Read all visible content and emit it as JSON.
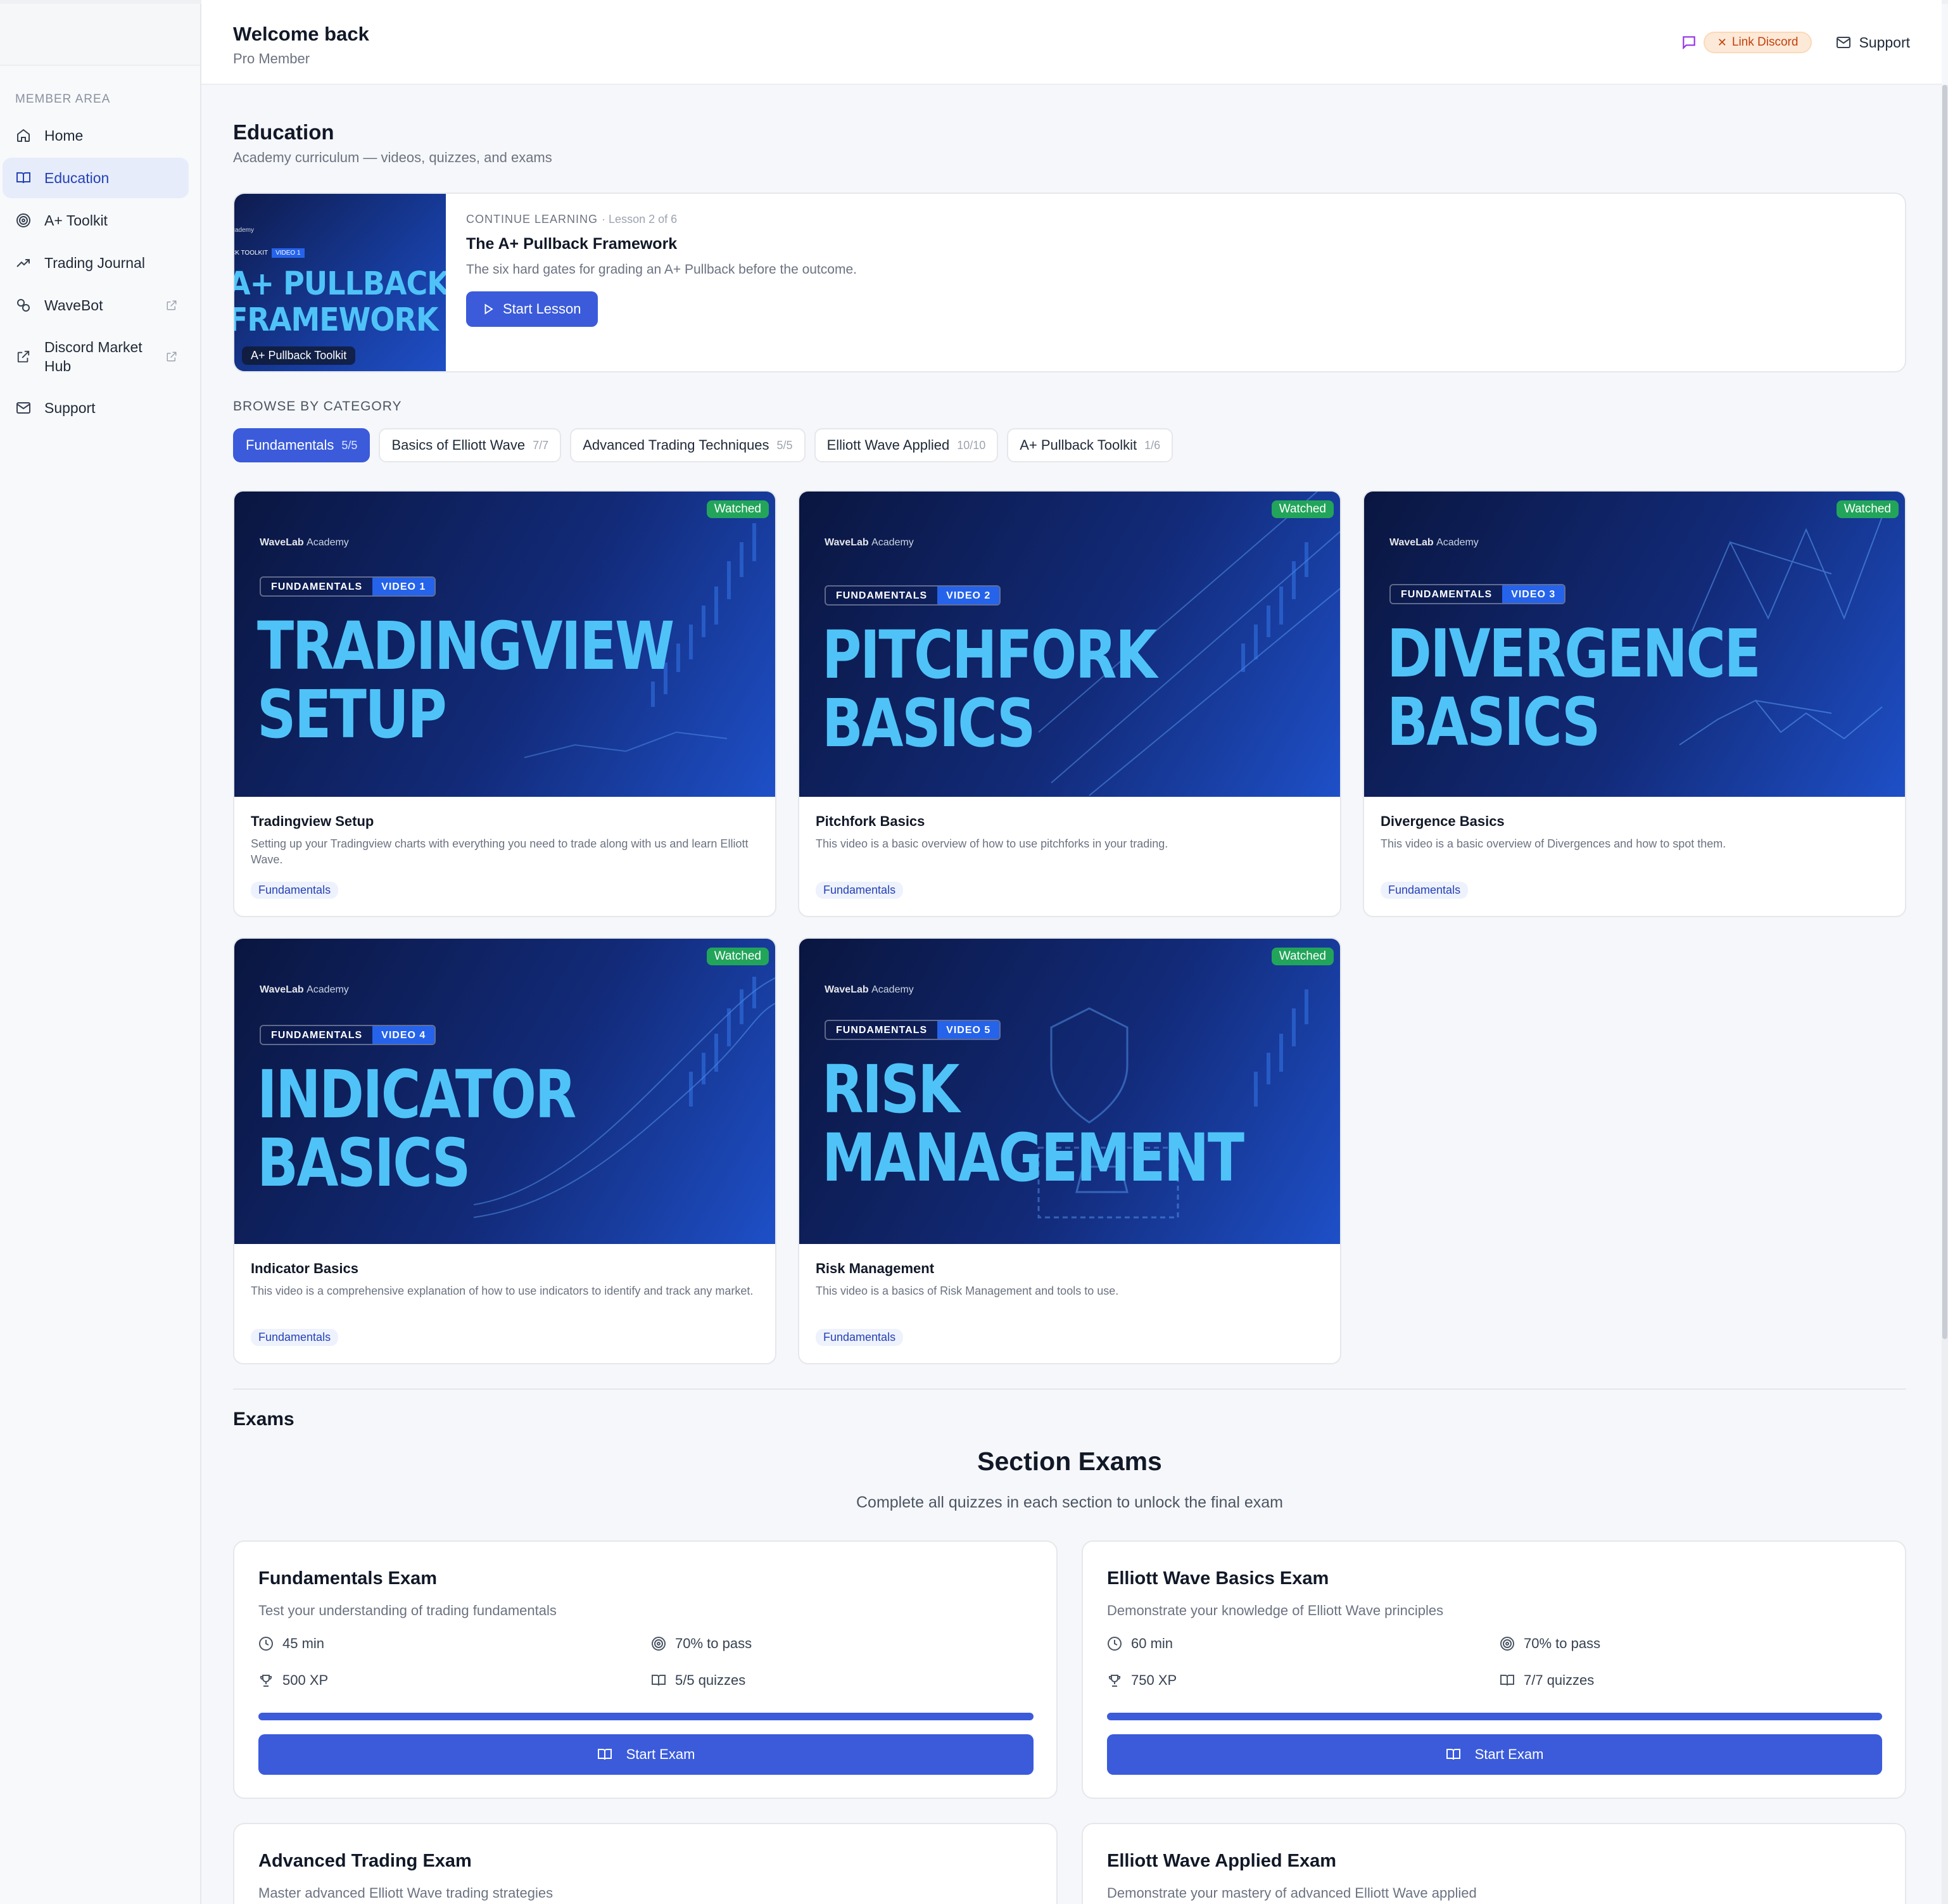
{
  "header": {
    "welcome": "Welcome back",
    "membership": "Pro Member",
    "discord_label": "Link Discord",
    "support_label": "Support"
  },
  "sidebar": {
    "section_label": "MEMBER AREA",
    "items": [
      {
        "label": "Home",
        "icon": "home-icon"
      },
      {
        "label": "Education",
        "icon": "book-icon",
        "active": true
      },
      {
        "label": "A+ Toolkit",
        "icon": "target-icon"
      },
      {
        "label": "Trading Journal",
        "icon": "trending-up-icon"
      },
      {
        "label": "WaveBot",
        "icon": "bot-icon",
        "external": true
      },
      {
        "label": "Discord Market Hub",
        "icon": "external-link-icon",
        "external": true
      },
      {
        "label": "Support",
        "icon": "mail-icon"
      }
    ]
  },
  "page": {
    "title": "Education",
    "subtitle": "Academy curriculum — videos, quizzes, and exams"
  },
  "continue": {
    "eyebrow": "CONTINUE LEARNING",
    "progress": "· Lesson 2 of 6",
    "title": "The A+ Pullback Framework",
    "description": "The six hard gates for grading an A+ Pullback before the outcome.",
    "button": "Start Lesson",
    "thumb_title": "A+ PULLBACK FRAMEWORK",
    "thumb_tag": "CK TOOLKIT",
    "thumb_video": "VIDEO 1",
    "thumb_label": "A+ Pullback Toolkit",
    "thumb_brand": "cademy"
  },
  "browse": {
    "label": "BROWSE BY CATEGORY",
    "categories": [
      {
        "label": "Fundamentals",
        "count": "5/5",
        "active": true
      },
      {
        "label": "Basics of Elliott Wave",
        "count": "7/7"
      },
      {
        "label": "Advanced Trading Techniques",
        "count": "5/5"
      },
      {
        "label": "Elliott Wave Applied",
        "count": "10/10"
      },
      {
        "label": "A+ Pullback Toolkit",
        "count": "1/6"
      }
    ]
  },
  "videos": [
    {
      "title": "Tradingview Setup",
      "description": "Setting up your Tradingview charts with everything you need to trade along with us and learn Elliott Wave.",
      "badge": "Fundamentals",
      "status": "Watched",
      "thumb_line1": "TRADINGVIEW",
      "thumb_line2": "SETUP",
      "thumb_cat": "FUNDAMENTALS",
      "thumb_video": "VIDEO 1",
      "brand": "WaveLab",
      "brand_sub": "Academy"
    },
    {
      "title": "Pitchfork Basics",
      "description": "This video is a basic overview of how to use pitchforks in your trading.",
      "badge": "Fundamentals",
      "status": "Watched",
      "thumb_line1": "PITCHFORK",
      "thumb_line2": "BASICS",
      "thumb_cat": "FUNDAMENTALS",
      "thumb_video": "VIDEO 2",
      "brand": "WaveLab",
      "brand_sub": "Academy"
    },
    {
      "title": "Divergence Basics",
      "description": "This video is a basic overview of Divergences and how to spot them.",
      "badge": "Fundamentals",
      "status": "Watched",
      "thumb_line1": "DIVERGENCE",
      "thumb_line2": "BASICS",
      "thumb_cat": "FUNDAMENTALS",
      "thumb_video": "VIDEO 3",
      "brand": "WaveLab",
      "brand_sub": "Academy"
    },
    {
      "title": "Indicator Basics",
      "description": "This video is a comprehensive explanation of how to use indicators to identify and track any market.",
      "badge": "Fundamentals",
      "status": "Watched",
      "thumb_line1": "INDICATOR",
      "thumb_line2": "BASICS",
      "thumb_cat": "FUNDAMENTALS",
      "thumb_video": "VIDEO 4",
      "brand": "WaveLab",
      "brand_sub": "Academy"
    },
    {
      "title": "Risk Management",
      "description": "This video is a basics of Risk Management and tools to use.",
      "badge": "Fundamentals",
      "status": "Watched",
      "thumb_line1": "RISK",
      "thumb_line2": "MANAGEMENT",
      "thumb_cat": "FUNDAMENTALS",
      "thumb_video": "VIDEO 5",
      "brand": "WaveLab",
      "brand_sub": "Academy"
    }
  ],
  "exams": {
    "heading": "Exams",
    "section_title": "Section Exams",
    "section_subtitle": "Complete all quizzes in each section to unlock the final exam",
    "cards": [
      {
        "title": "Fundamentals Exam",
        "description": "Test your understanding of trading fundamentals",
        "duration": "45 min",
        "pass": "70% to pass",
        "xp": "500 XP",
        "quizzes": "5/5 quizzes",
        "progress": 1.0,
        "button": "Start Exam"
      },
      {
        "title": "Elliott Wave Basics Exam",
        "description": "Demonstrate your knowledge of Elliott Wave principles",
        "duration": "60 min",
        "pass": "70% to pass",
        "xp": "750 XP",
        "quizzes": "7/7 quizzes",
        "progress": 1.0,
        "button": "Start Exam"
      },
      {
        "title": "Advanced Trading Exam",
        "description": "Master advanced Elliott Wave trading strategies"
      },
      {
        "title": "Elliott Wave Applied Exam",
        "description": "Demonstrate your mastery of advanced Elliott Wave applied"
      }
    ]
  },
  "colors": {
    "accent": "#3b5bdb",
    "watched": "#22a55a",
    "discord_bg": "#fde9d7",
    "thumb_title": "#4fc3f7"
  }
}
